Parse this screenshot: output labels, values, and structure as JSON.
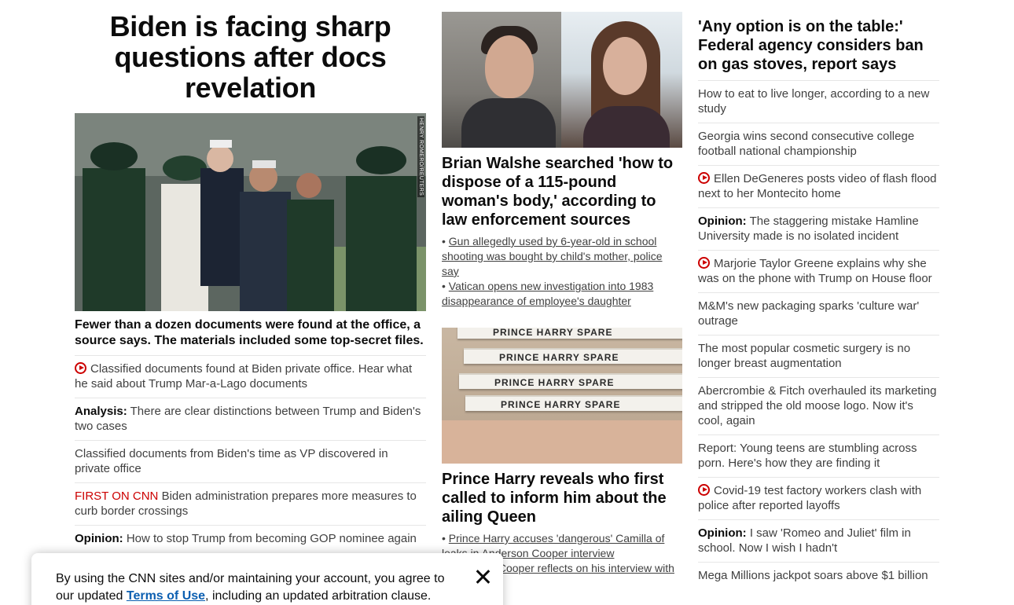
{
  "left": {
    "title": "Biden is facing sharp questions after docs revelation",
    "image_credit": "HENRY ROMERO/REUTERS",
    "summary": "Fewer than a dozen documents were found at the office, a source says. The materials included some top-secret files.",
    "items": [
      {
        "video": true,
        "label": "",
        "text": "Classified documents found at Biden private office. Hear what he said about Trump Mar-a-Lago documents"
      },
      {
        "video": false,
        "label": "Analysis:",
        "text": "There are clear distinctions between Trump and Biden's two cases"
      },
      {
        "video": false,
        "label": "",
        "text": "Classified documents from Biden's time as VP discovered in private office"
      },
      {
        "video": false,
        "label": "",
        "red_label": "FIRST ON CNN",
        "text": "Biden administration prepares more measures to curb border crossings"
      },
      {
        "video": false,
        "label": "Opinion:",
        "text": "How to stop Trump from becoming GOP nominee again"
      }
    ]
  },
  "middle": {
    "story1": {
      "title": "Brian Walshe searched 'how to dispose of a 115-pound woman's body,' according to law enforcement sources",
      "bullets": [
        "Gun allegedly used by 6-year-old in school shooting was bought by child's mother, police say",
        "Vatican opens new investigation into 1983 disappearance of employee's daughter"
      ]
    },
    "story2": {
      "book_text": "PRINCE HARRY   SPARE",
      "title": "Prince Harry reveals who first called to inform him about the ailing Queen",
      "bullets": [
        "Prince Harry accuses 'dangerous' Camilla of leaks in Anderson Cooper interview",
        "Anderson Cooper reflects on his interview with Prince Harry"
      ]
    }
  },
  "right": {
    "title": "'Any option is on the table:' Federal agency considers ban on gas stoves, report says",
    "items": [
      {
        "video": false,
        "label": "",
        "text": "How to eat to live longer, according to a new study"
      },
      {
        "video": false,
        "label": "",
        "text": "Georgia wins second consecutive college football national championship"
      },
      {
        "video": true,
        "label": "",
        "text": "Ellen DeGeneres posts video of flash flood next to her Montecito home"
      },
      {
        "video": false,
        "label": "Opinion:",
        "text": "The staggering mistake Hamline University made is no isolated incident"
      },
      {
        "video": true,
        "label": "",
        "text": "Marjorie Taylor Greene explains why she was on the phone with Trump on House floor"
      },
      {
        "video": false,
        "label": "",
        "text": "M&M's new packaging sparks 'culture war' outrage"
      },
      {
        "video": false,
        "label": "",
        "text": "The most popular cosmetic surgery is no longer breast augmentation"
      },
      {
        "video": false,
        "label": "",
        "text": "Abercrombie & Fitch overhauled its marketing and stripped the old moose logo. Now it's cool, again"
      },
      {
        "video": false,
        "label": "",
        "text": "Report: Young teens are stumbling across porn. Here's how they are finding it"
      },
      {
        "video": true,
        "label": "",
        "text": "Covid-19 test factory workers clash with police after reported layoffs"
      },
      {
        "video": false,
        "label": "Opinion:",
        "text": "I saw 'Romeo and Juliet' film in school. Now I wish I hadn't"
      },
      {
        "video": false,
        "label": "",
        "text": "Mega Millions jackpot soars above $1 billion"
      }
    ]
  },
  "cookie_banner": {
    "text_before": "By using the CNN sites and/or maintaining your account, you agree to our updated ",
    "terms_link": "Terms of Use",
    "text_after": ", including an updated arbitration clause."
  },
  "colors": {
    "accent_red": "#cc0000",
    "link_blue": "#0c5fb1"
  }
}
